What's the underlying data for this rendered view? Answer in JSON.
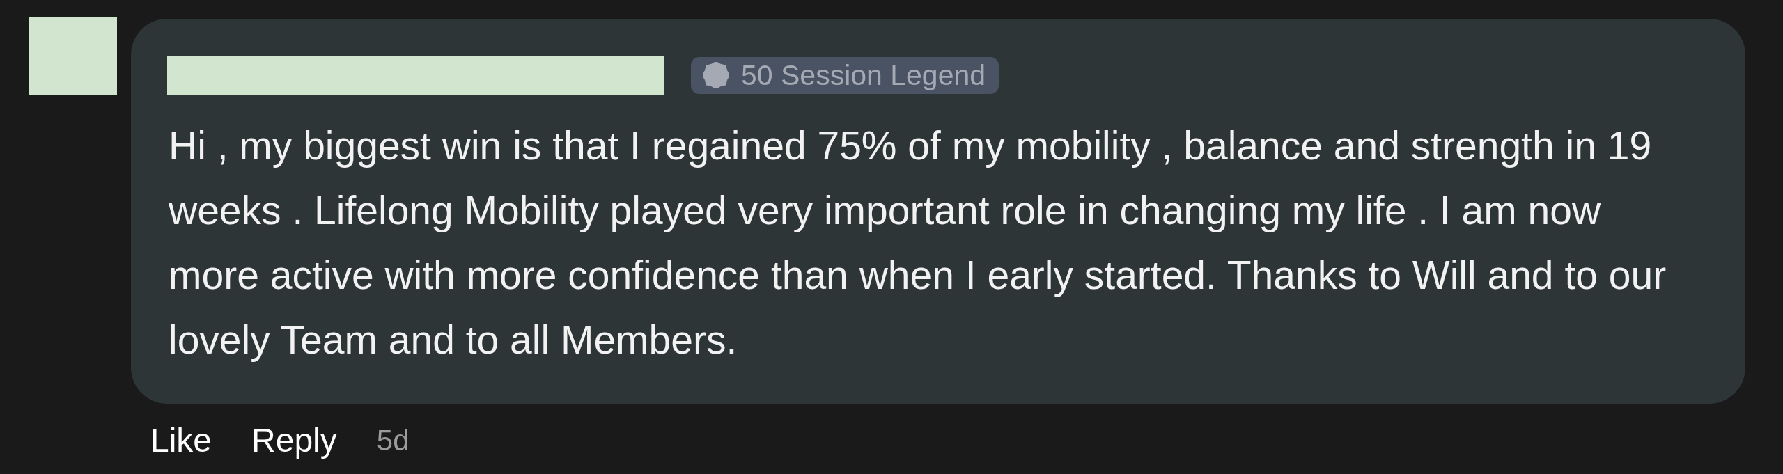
{
  "comment": {
    "badge": {
      "label": "50 Session Legend"
    },
    "text": "Hi , my biggest win is that I regained 75% of my mobility , balance and strength in 19 weeks . Lifelong Mobility played very important role in changing my life . I am now more active with more confidence than when I early started. Thanks to Will and to our lovely Team and to all Members.",
    "actions": [
      {
        "label": "Like"
      },
      {
        "label": "Reply"
      }
    ],
    "timestamp": "5d"
  }
}
